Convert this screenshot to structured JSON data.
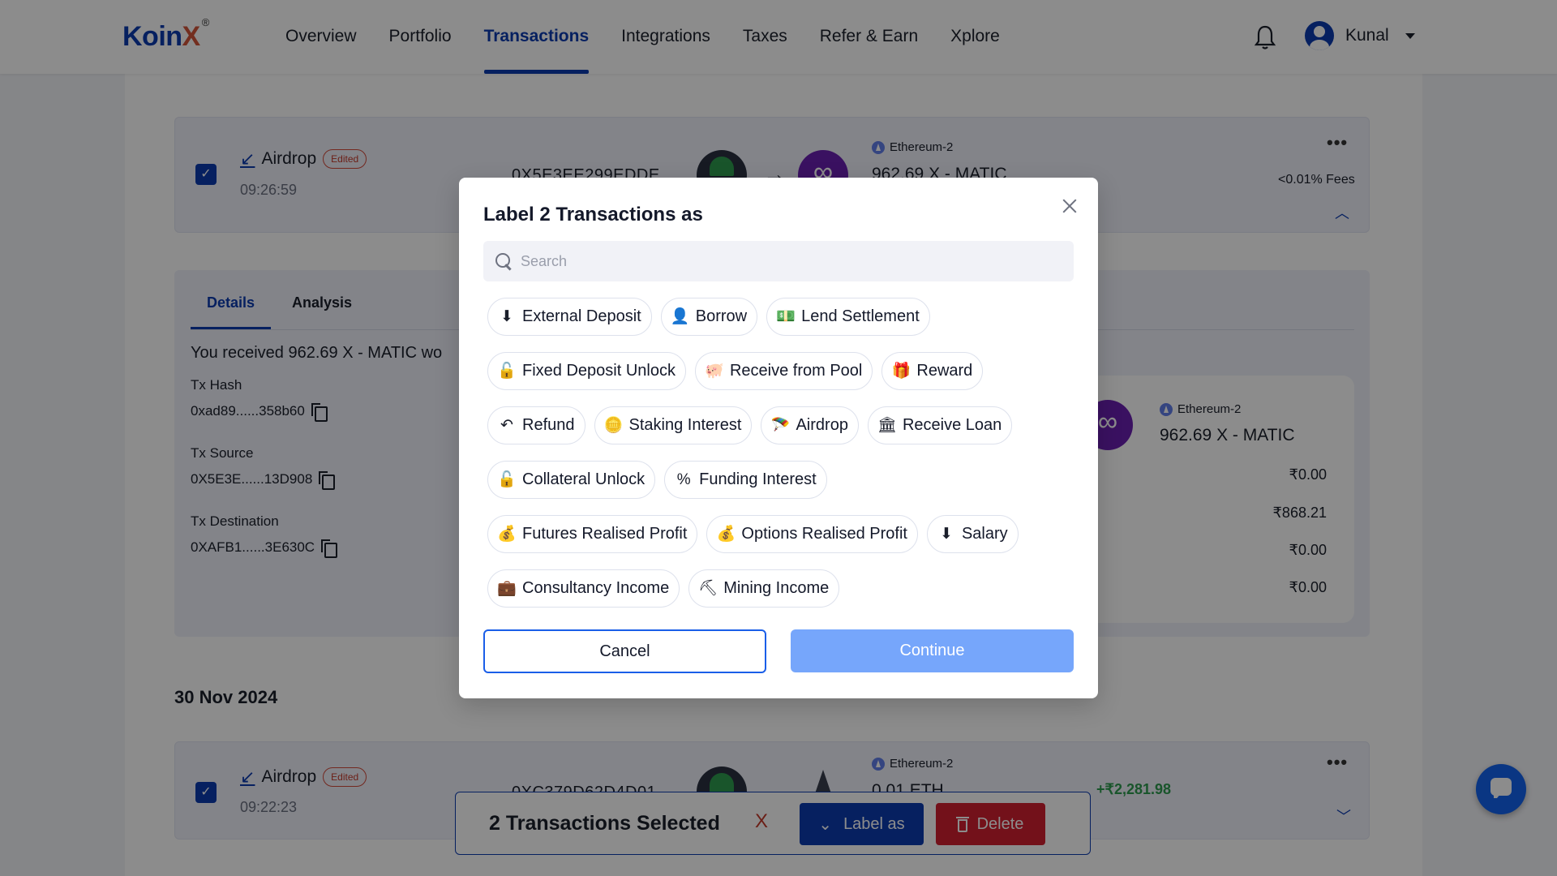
{
  "brand": {
    "name_main": "Koin",
    "name_accent": "X",
    "trademark": "®"
  },
  "nav": {
    "links": [
      "Overview",
      "Portfolio",
      "Transactions",
      "Integrations",
      "Taxes",
      "Refer & Earn",
      "Xplore"
    ],
    "active": "Transactions"
  },
  "user": {
    "name": "Kunal"
  },
  "transactions": [
    {
      "type": "Airdrop",
      "badge": "Edited",
      "time": "09:26:59",
      "address": "0X5E3EE299EDDE",
      "chain": "Ethereum-2",
      "amount": "962.69 X - MATIC",
      "fees": "<0.01% Fees",
      "checked": true,
      "expanded": true
    },
    {
      "type": "Airdrop",
      "badge": "Edited",
      "time": "09:22:23",
      "address": "0XC379D62D4D01",
      "chain": "Ethereum-2",
      "amount": "0.01 ETH",
      "gain": "+₹2,281.98",
      "checked": true,
      "expanded": false
    }
  ],
  "details": {
    "tabs": [
      "Details",
      "Analysis"
    ],
    "active_tab": "Details",
    "summary": "You received 962.69 X - MATIC wo",
    "tx_hash_label": "Tx Hash",
    "tx_hash": "0xad89......358b60",
    "tx_source_label": "Tx Source",
    "tx_source": "0X5E3E......13D908",
    "tx_destination_label": "Tx Destination",
    "tx_destination": "0XAFB1......3E630C",
    "receive_chain": "Ethereum-2",
    "receive_amount": "962.69 X - MATIC",
    "values": [
      "₹0.00",
      "₹868.21",
      "₹0.00",
      "₹0.00"
    ]
  },
  "date_group": "30 Nov 2024",
  "selection_bar": {
    "text": "2 Transactions Selected",
    "clear": "X",
    "label_as": "Label as",
    "delete": "Delete"
  },
  "modal": {
    "title": "Label 2 Transactions as",
    "search_placeholder": "Search",
    "search_value": "",
    "chip_rows": [
      [
        {
          "label": "External Deposit",
          "icon": "deposit-icon"
        },
        {
          "label": "Borrow",
          "icon": "borrow-icon"
        },
        {
          "label": "Lend Settlement",
          "icon": "lend-settlement-icon"
        }
      ],
      [
        {
          "label": "Fixed Deposit Unlock",
          "icon": "unlock-icon"
        },
        {
          "label": "Receive from Pool",
          "icon": "piggy-bank-icon"
        },
        {
          "label": "Reward",
          "icon": "gift-icon"
        }
      ],
      [
        {
          "label": "Refund",
          "icon": "refund-icon"
        },
        {
          "label": "Staking Interest",
          "icon": "coins-icon"
        },
        {
          "label": "Airdrop",
          "icon": "parachute-icon"
        },
        {
          "label": "Receive Loan",
          "icon": "bank-icon"
        }
      ],
      [
        {
          "label": "Collateral Unlock",
          "icon": "unlock-check-icon"
        },
        {
          "label": "Funding Interest",
          "icon": "percent-bag-icon"
        }
      ],
      [
        {
          "label": "Futures Realised Profit",
          "icon": "money-bag-icon"
        },
        {
          "label": "Options Realised Profit",
          "icon": "money-bag-icon"
        },
        {
          "label": "Salary",
          "icon": "deposit-icon"
        }
      ],
      [
        {
          "label": "Consultancy Income",
          "icon": "briefcase-icon"
        },
        {
          "label": "Mining Income",
          "icon": "pickaxe-icon"
        }
      ]
    ],
    "cancel": "Cancel",
    "continue": "Continue"
  }
}
